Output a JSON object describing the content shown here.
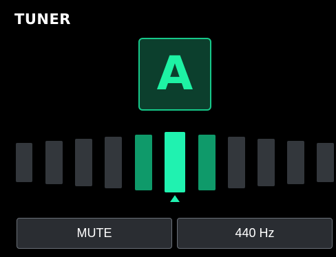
{
  "header": {
    "title": "TUNER"
  },
  "tuner": {
    "note": "A",
    "cents_offset": 0,
    "segment_states": [
      "off",
      "off",
      "off",
      "off",
      "near",
      "center",
      "near",
      "off",
      "off",
      "off",
      "off"
    ]
  },
  "buttons": {
    "mute_label": "MUTE",
    "reference_label": "440 Hz"
  },
  "colors": {
    "background": "#000000",
    "segment_off": "#33373c",
    "segment_near": "#0f9a6a",
    "segment_center": "#20f2b0",
    "note_text": "#1ef2a4",
    "note_border": "#16c98a",
    "note_fill": "#0c3f2d"
  }
}
